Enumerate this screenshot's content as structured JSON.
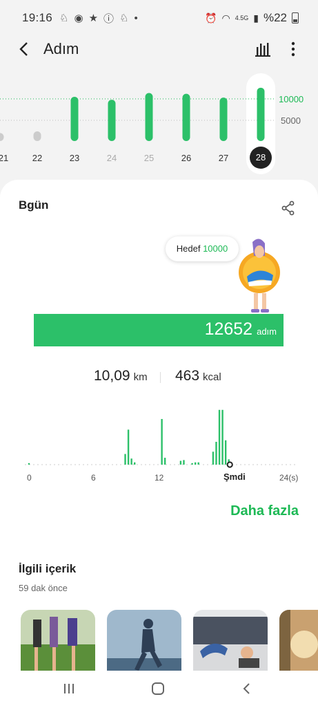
{
  "status_bar": {
    "time": "19:16",
    "network": "4.5G",
    "battery_percent": "%22"
  },
  "app_bar": {
    "title": "Adım"
  },
  "weekly": {
    "goal_label": "10000",
    "half_label": "5000",
    "selected_day": "28",
    "days": [
      {
        "label": "21",
        "steps": 1900,
        "style": "grey"
      },
      {
        "label": "22",
        "steps": 2300,
        "style": "grey"
      },
      {
        "label": "23",
        "steps": 10500,
        "style": "green"
      },
      {
        "label": "24",
        "steps": 9800,
        "style": "green"
      },
      {
        "label": "25",
        "steps": 11400,
        "style": "green"
      },
      {
        "label": "26",
        "steps": 11200,
        "style": "green"
      },
      {
        "label": "27",
        "steps": 10300,
        "style": "green"
      },
      {
        "label": "28",
        "steps": 12652,
        "style": "green"
      }
    ]
  },
  "today": {
    "title": "Bgün",
    "goal_text": "Hedef",
    "goal_value": "10000",
    "steps": "12652",
    "steps_unit": "adım",
    "steps_ratio": 1.0,
    "distance": "10,09",
    "distance_unit": "km",
    "calories": "463",
    "calories_unit": "kcal",
    "more_label": "Daha fazla"
  },
  "hourly_chart": {
    "x_ticks": [
      "0",
      "6",
      "12",
      "Şmdi",
      "24(s)"
    ],
    "now_hour": 19.2,
    "bars": [
      {
        "hour": 0,
        "v": 2
      },
      {
        "hour": 9.2,
        "v": 14
      },
      {
        "hour": 9.5,
        "v": 46
      },
      {
        "hour": 9.8,
        "v": 8
      },
      {
        "hour": 10.1,
        "v": 3
      },
      {
        "hour": 12.7,
        "v": 60
      },
      {
        "hour": 13.0,
        "v": 9
      },
      {
        "hour": 14.5,
        "v": 5
      },
      {
        "hour": 14.8,
        "v": 6
      },
      {
        "hour": 15.6,
        "v": 2
      },
      {
        "hour": 15.9,
        "v": 3
      },
      {
        "hour": 16.2,
        "v": 3
      },
      {
        "hour": 17.6,
        "v": 17
      },
      {
        "hour": 17.9,
        "v": 30
      },
      {
        "hour": 18.2,
        "v": 72
      },
      {
        "hour": 18.5,
        "v": 72
      },
      {
        "hour": 18.8,
        "v": 32
      },
      {
        "hour": 19.1,
        "v": 7
      }
    ]
  },
  "related": {
    "title": "İlgili içerik",
    "subtitle": "59 dak önce"
  },
  "colors": {
    "accent_green": "#2cc069",
    "text_green": "#1db955",
    "grey_bar": "#cccccc"
  }
}
